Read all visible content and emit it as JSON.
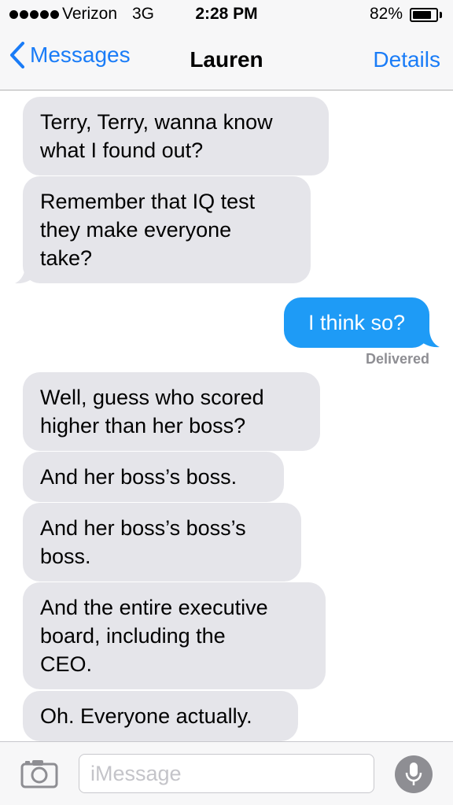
{
  "status_bar": {
    "carrier": "Verizon",
    "network": "3G",
    "time": "2:28 PM",
    "battery_percent": "82%",
    "battery_level": 0.82,
    "signal_bars": 5
  },
  "nav": {
    "back_label": "Messages",
    "title": "Lauren",
    "details_label": "Details"
  },
  "messages": [
    {
      "from": "them",
      "text": "Terry, Terry, wanna know\nwhat I found out?"
    },
    {
      "from": "them",
      "text": "Remember that IQ test\nthey make everyone\ntake?"
    },
    {
      "from": "me",
      "text": "I think so?"
    },
    {
      "from": "them",
      "text": "Well, guess who scored\nhigher than her boss?"
    },
    {
      "from": "them",
      "text": "And her boss’s boss."
    },
    {
      "from": "them",
      "text": "And her boss’s boss’s\nboss."
    },
    {
      "from": "them",
      "text": "And the entire executive\nboard, including the\nCEO."
    },
    {
      "from": "them",
      "text": "Oh. Everyone actually."
    }
  ],
  "delivered_label": "Delivered",
  "composer": {
    "placeholder": "iMessage",
    "value": ""
  },
  "colors": {
    "accent": "#1a7cf7",
    "outgoing_bubble": "#1e9bf6",
    "incoming_bubble": "#e5e5ea"
  }
}
